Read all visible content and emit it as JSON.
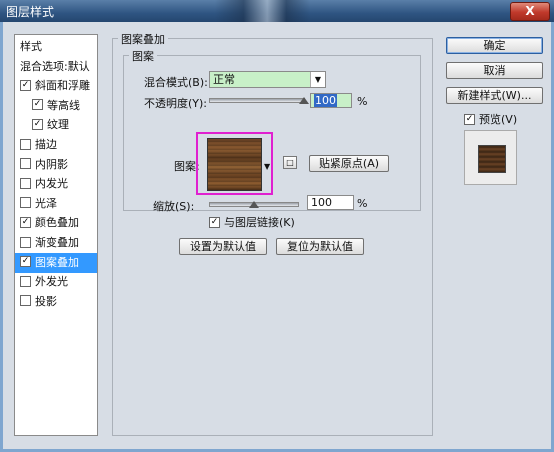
{
  "window": {
    "title": "图层样式",
    "close_glyph": "X"
  },
  "styles_list": {
    "items": [
      {
        "label": "样式",
        "checkbox": false,
        "checked": false,
        "selected": false,
        "indent": false
      },
      {
        "label": "混合选项:默认",
        "checkbox": false,
        "checked": false,
        "selected": false,
        "indent": false
      },
      {
        "label": "斜面和浮雕",
        "checkbox": true,
        "checked": true,
        "selected": false,
        "indent": false
      },
      {
        "label": "等高线",
        "checkbox": true,
        "checked": true,
        "selected": false,
        "indent": true
      },
      {
        "label": "纹理",
        "checkbox": true,
        "checked": true,
        "selected": false,
        "indent": true
      },
      {
        "label": "描边",
        "checkbox": true,
        "checked": false,
        "selected": false,
        "indent": false
      },
      {
        "label": "内阴影",
        "checkbox": true,
        "checked": false,
        "selected": false,
        "indent": false
      },
      {
        "label": "内发光",
        "checkbox": true,
        "checked": false,
        "selected": false,
        "indent": false
      },
      {
        "label": "光泽",
        "checkbox": true,
        "checked": false,
        "selected": false,
        "indent": false
      },
      {
        "label": "颜色叠加",
        "checkbox": true,
        "checked": true,
        "selected": false,
        "indent": false
      },
      {
        "label": "渐变叠加",
        "checkbox": true,
        "checked": false,
        "selected": false,
        "indent": false
      },
      {
        "label": "图案叠加",
        "checkbox": true,
        "checked": true,
        "selected": true,
        "indent": false
      },
      {
        "label": "外发光",
        "checkbox": true,
        "checked": false,
        "selected": false,
        "indent": false
      },
      {
        "label": "投影",
        "checkbox": true,
        "checked": false,
        "selected": false,
        "indent": false
      }
    ]
  },
  "panel": {
    "title": "图案叠加",
    "group_title": "图案",
    "blend_mode_label": "混合模式(B):",
    "blend_mode_value": "正常",
    "opacity_label": "不透明度(Y):",
    "opacity_value": "100",
    "opacity_unit": "%",
    "opacity_fraction": 1.0,
    "pattern_label": "图案:",
    "snap_origin_button": "贴紧原点(A)",
    "scale_label": "缩放(S):",
    "scale_value": "100",
    "scale_unit": "%",
    "scale_fraction": 0.5,
    "link_label": "与图层链接(K)",
    "link_checked": true,
    "set_default_button": "设置为默认值",
    "reset_default_button": "复位为默认值"
  },
  "right": {
    "ok_button": "确定",
    "cancel_button": "取消",
    "new_style_button": "新建样式(W)...",
    "preview_label": "预览(V)",
    "preview_checked": true
  },
  "colors": {
    "selection": "#3399ff",
    "highlight_frame": "#e020d0",
    "field_green": "#c8f0c8"
  }
}
